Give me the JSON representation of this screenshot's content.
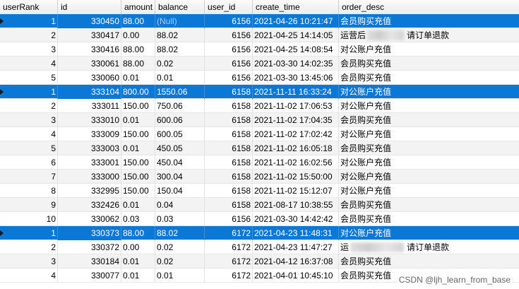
{
  "columns": [
    "userRank",
    "id",
    "amount",
    "balance",
    "user_id",
    "create_time",
    "order_desc"
  ],
  "rows": [
    {
      "userRank": "1",
      "id": "330450",
      "amount": "88.00",
      "balance": "(Null)",
      "user_id": "6156",
      "create_time": "2021-04-26 10:21:47",
      "order_desc": "会员购买充值",
      "selected": true,
      "pointer": true
    },
    {
      "userRank": "2",
      "id": "330417",
      "amount": "0.00",
      "balance": "88.02",
      "user_id": "6156",
      "create_time": "2021-04-25 14:14:05",
      "order_desc_left": "运营后",
      "order_desc_right": "请订单退款",
      "blurred": true
    },
    {
      "userRank": "3",
      "id": "330416",
      "amount": "88.00",
      "balance": "88.02",
      "user_id": "6156",
      "create_time": "2021-04-25 14:08:54",
      "order_desc": "对公账户充值"
    },
    {
      "userRank": "4",
      "id": "330061",
      "amount": "88.00",
      "balance": "0.02",
      "user_id": "6156",
      "create_time": "2021-03-30 14:02:35",
      "order_desc": "会员购买充值"
    },
    {
      "userRank": "5",
      "id": "330060",
      "amount": "0.01",
      "balance": "0.01",
      "user_id": "6156",
      "create_time": "2021-03-30 13:45:06",
      "order_desc": "会员购买充值"
    },
    {
      "userRank": "1",
      "id": "333104",
      "amount": "800.00",
      "balance": "1550.06",
      "user_id": "6158",
      "create_time": "2021-11-11 16:33:24",
      "order_desc": "对公账户充值",
      "selected": true,
      "pointer": true
    },
    {
      "userRank": "2",
      "id": "333011",
      "amount": "150.00",
      "balance": "750.06",
      "user_id": "6158",
      "create_time": "2021-11-02 17:06:53",
      "order_desc": "对公账户充值"
    },
    {
      "userRank": "3",
      "id": "333010",
      "amount": "0.01",
      "balance": "600.06",
      "user_id": "6158",
      "create_time": "2021-11-02 17:04:35",
      "order_desc": "会员购买充值"
    },
    {
      "userRank": "4",
      "id": "333009",
      "amount": "150.00",
      "balance": "600.05",
      "user_id": "6158",
      "create_time": "2021-11-02 17:02:42",
      "order_desc": "对公账户充值"
    },
    {
      "userRank": "5",
      "id": "333003",
      "amount": "0.01",
      "balance": "450.05",
      "user_id": "6158",
      "create_time": "2021-11-02 16:05:18",
      "order_desc": "会员购买充值"
    },
    {
      "userRank": "6",
      "id": "333001",
      "amount": "150.00",
      "balance": "450.04",
      "user_id": "6158",
      "create_time": "2021-11-02 16:02:56",
      "order_desc": "对公账户充值"
    },
    {
      "userRank": "7",
      "id": "333000",
      "amount": "150.00",
      "balance": "300.04",
      "user_id": "6158",
      "create_time": "2021-11-02 15:50:00",
      "order_desc": "对公账户充值"
    },
    {
      "userRank": "8",
      "id": "332995",
      "amount": "150.00",
      "balance": "150.04",
      "user_id": "6158",
      "create_time": "2021-11-02 15:12:07",
      "order_desc": "对公账户充值"
    },
    {
      "userRank": "9",
      "id": "332426",
      "amount": "0.01",
      "balance": "0.04",
      "user_id": "6158",
      "create_time": "2021-08-17 10:38:55",
      "order_desc": "会员购买充值"
    },
    {
      "userRank": "10",
      "id": "330062",
      "amount": "0.03",
      "balance": "0.03",
      "user_id": "6156",
      "create_time": "2021-03-30 14:42:42",
      "order_desc": "会员购买充值"
    },
    {
      "userRank": "1",
      "id": "330373",
      "amount": "88.00",
      "balance": "88.02",
      "user_id": "6172",
      "create_time": "2021-04-23 11:48:31",
      "order_desc": "对公账户充值",
      "selected": true,
      "pointer": true
    },
    {
      "userRank": "2",
      "id": "330372",
      "amount": "0.00",
      "balance": "0.02",
      "user_id": "6172",
      "create_time": "2021-04-23 11:47:27",
      "order_desc_left": "运",
      "order_desc_right": "请订单退款",
      "blurred": true
    },
    {
      "userRank": "3",
      "id": "330184",
      "amount": "0.01",
      "balance": "0.02",
      "user_id": "6172",
      "create_time": "2021-04-12 16:37:08",
      "order_desc": "会员购买充值"
    },
    {
      "userRank": "4",
      "id": "330077",
      "amount": "0.01",
      "balance": "0.01",
      "user_id": "6172",
      "create_time": "2021-04-01 10:45:10",
      "order_desc": "会员购买充值"
    }
  ],
  "watermark": "CSDN @ljh_learn_from_base"
}
